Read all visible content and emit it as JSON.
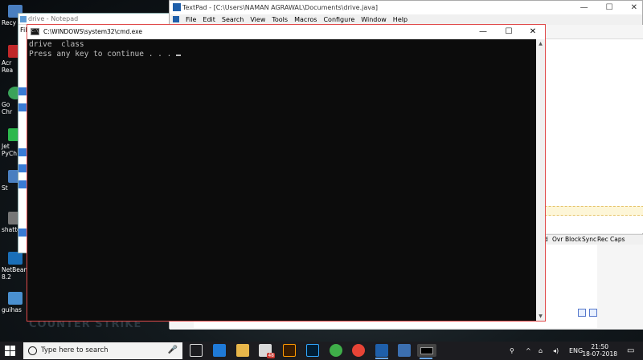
{
  "desktop": {
    "wallpaper_text": "COUNTER STRIKE",
    "icons": [
      {
        "label": "Recy",
        "color": "#4a7fc0"
      },
      {
        "label": "Acr",
        "label2": "Rea",
        "color": "#c0282a"
      },
      {
        "label": "Go",
        "label2": "Chr",
        "color": "#3aa35a"
      },
      {
        "label": "Jet",
        "label2": "PyCh",
        "color": "#2db84d"
      },
      {
        "label": "St",
        "color": "#4a7fc0"
      },
      {
        "label": "shatte",
        "color": "#777777"
      },
      {
        "label": "NetBean",
        "label2": "8.2",
        "color": "#1a6fb8"
      },
      {
        "label": "guihas",
        "color": "#4a90d0"
      }
    ]
  },
  "notepad": {
    "title": "drive - Notepad",
    "menu_first": "File"
  },
  "textpad": {
    "title": "TextPad - [C:\\Users\\NAMAN AGRAWAL\\Documents\\drive.java]",
    "minimize": "—",
    "maximize": "☐",
    "close": "✕",
    "menu": [
      "File",
      "Edit",
      "Search",
      "View",
      "Tools",
      "Macros",
      "Configure",
      "Window",
      "Help"
    ],
    "status": [
      "d",
      "Ovr",
      "Block",
      "Sync",
      "Rec",
      "Caps"
    ]
  },
  "cmd": {
    "title": "C:\\WINDOWS\\system32\\cmd.exe",
    "icon_text": "C:\\",
    "minimize": "—",
    "maximize": "☐",
    "close": "✕",
    "lines": [
      "drive  class",
      "Press any key to continue . . . "
    ],
    "scroll_up": "▲",
    "scroll_down": "▼"
  },
  "taskbar": {
    "search_placeholder": "Type here to search",
    "mic_icon": "🎤",
    "mail_badge": "48",
    "tray_network": "⌂",
    "tray_volume": "◂)",
    "language": "ENG",
    "time": "21:50",
    "date": "18-07-2018",
    "notification_icon": "▭"
  }
}
